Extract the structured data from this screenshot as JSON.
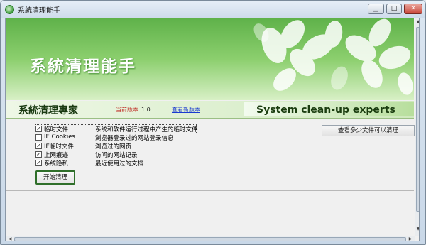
{
  "window": {
    "title": "系統清理能手"
  },
  "caption_buttons": {
    "minimize": "▁",
    "maximize": "□",
    "close": "✕"
  },
  "banner": {
    "title": "系統清理能手"
  },
  "header": {
    "cn_slogan": "系統清理專家",
    "version_label": "当前版本",
    "version_value": "1.0",
    "check_update_link": "查看新版本",
    "en_slogan": "System clean-up experts"
  },
  "items": [
    {
      "name": "临时文件",
      "desc": "系统和软件运行过程中产生的临时文件",
      "checked": true
    },
    {
      "name": "IE Cookies",
      "desc": "浏览器登录过的网站登录信息",
      "checked": false
    },
    {
      "name": "IE临时文件",
      "desc": "浏览过的网页",
      "checked": true
    },
    {
      "name": "上网痕迹",
      "desc": "访问的网站记录",
      "checked": true
    },
    {
      "name": "系统隐私",
      "desc": "最近使用过的文档",
      "checked": true
    }
  ],
  "buttons": {
    "scan": "查看多少文件可以清理",
    "start": "开始清理"
  },
  "check_mark": "✓",
  "colors": {
    "banner_green": "#5fb24a",
    "version_red": "#c0322a",
    "link_blue": "#1a3ad0"
  }
}
